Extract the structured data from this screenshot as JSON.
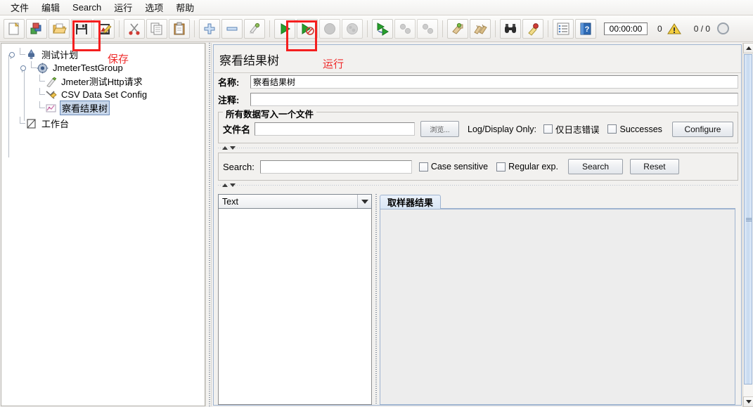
{
  "menu": {
    "items": [
      {
        "label": "文件",
        "name": "menu-file"
      },
      {
        "label": "编辑",
        "name": "menu-edit"
      },
      {
        "label": "Search",
        "name": "menu-search"
      },
      {
        "label": "运行",
        "name": "menu-run"
      },
      {
        "label": "选项",
        "name": "menu-options"
      },
      {
        "label": "帮助",
        "name": "menu-help"
      }
    ]
  },
  "toolbar": {
    "timer": "00:00:00",
    "error_count": "0",
    "thread_ratio": "0 / 0",
    "icons": [
      "new-icon",
      "templates-icon",
      "open-icon",
      "save-icon",
      "save-as-image-icon",
      "cut-icon",
      "copy-icon",
      "paste-icon",
      "expand-icon",
      "collapse-icon",
      "toggle-icon",
      "start-icon",
      "start-no-pauses-icon",
      "stop-icon",
      "shutdown-icon",
      "start-remote-icon",
      "stop-remote-icon",
      "shutdown-remote-icon",
      "clear-icon",
      "clear-all-icon",
      "search-icon",
      "search-reset-icon",
      "function-helper-icon",
      "help-icon"
    ]
  },
  "annotations": {
    "save_label": "保存",
    "run_label": "运行"
  },
  "tree": {
    "nodes": [
      {
        "label": "测试计划",
        "icon": "test-plan-icon",
        "selected": false
      },
      {
        "label": "JmeterTestGroup",
        "icon": "thread-group-icon",
        "selected": false
      },
      {
        "label": "Jmeter测试Http请求",
        "icon": "http-request-icon",
        "selected": false
      },
      {
        "label": "CSV Data Set Config",
        "icon": "csv-data-set-icon",
        "selected": false
      },
      {
        "label": "察看结果树",
        "icon": "view-results-tree-icon",
        "selected": true
      },
      {
        "label": "工作台",
        "icon": "workbench-icon",
        "selected": false
      }
    ]
  },
  "panel": {
    "title": "察看结果树",
    "name_label": "名称:",
    "name_value": "察看结果树",
    "comment_label": "注释:",
    "comment_value": "",
    "file_group": {
      "title": "所有数据写入一个文件",
      "filename_label": "文件名",
      "filename_value": "",
      "browse_button": "浏览...",
      "log_display_label": "Log/Display Only:",
      "errors_only_label": "仅日志错误",
      "errors_only_checked": false,
      "successes_label": "Successes",
      "successes_checked": false,
      "configure_button": "Configure"
    },
    "search_group": {
      "search_label": "Search:",
      "search_value": "",
      "case_sensitive_label": "Case sensitive",
      "case_sensitive_checked": false,
      "regular_exp_label": "Regular exp.",
      "regular_exp_checked": false,
      "search_button": "Search",
      "reset_button": "Reset"
    },
    "renderer": {
      "selected": "Text"
    },
    "tabs": [
      {
        "label": "取样器结果",
        "active": true
      }
    ]
  },
  "colors": {
    "accent_blue": "#9fb4d0",
    "selection_blue": "#c7d6ea",
    "annotation_red": "#ef2b2b",
    "run_green": "#2d9e34",
    "warning_yellow": "#f2c233"
  }
}
